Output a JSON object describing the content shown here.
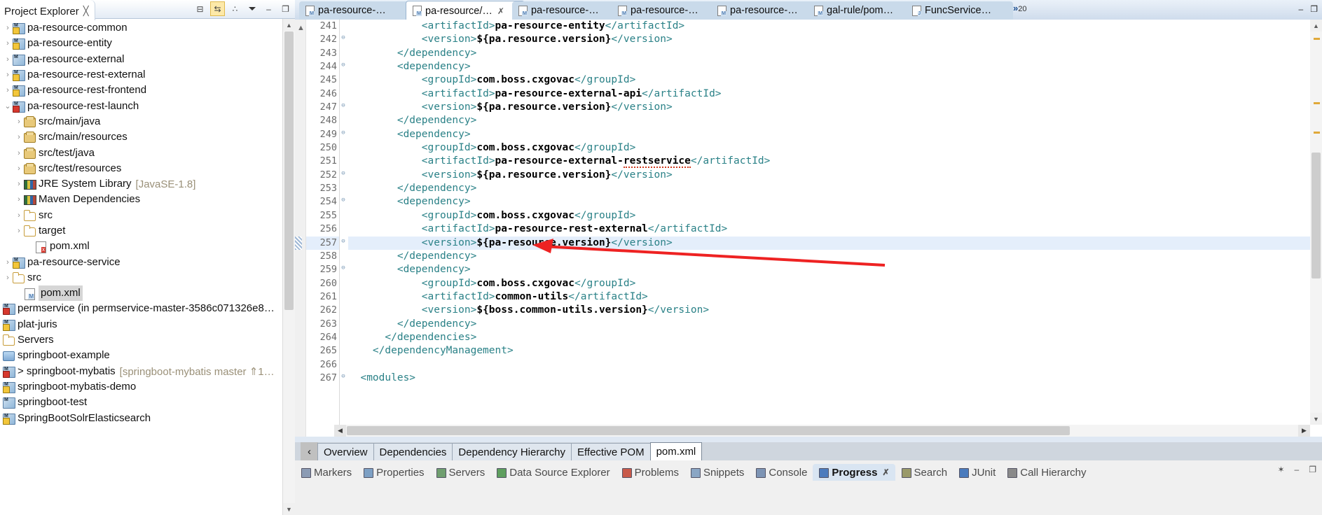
{
  "explorer": {
    "title": "Project Explorer",
    "close_glyph": "╳",
    "toolbar": [
      {
        "name": "collapse-all-button",
        "glyph": "⊟"
      },
      {
        "name": "link-with-editor-button",
        "glyph": "⇆"
      },
      {
        "name": "view-menu-button",
        "glyph": "∴"
      }
    ],
    "items": [
      {
        "label": "pa-resource-common",
        "indent": 0,
        "arrow": "›",
        "icon": "maven-project-warn-icon"
      },
      {
        "label": "pa-resource-entity",
        "indent": 0,
        "arrow": "›",
        "icon": "maven-project-warn-icon"
      },
      {
        "label": "pa-resource-external",
        "indent": 0,
        "arrow": "›",
        "icon": "maven-project-icon"
      },
      {
        "label": "pa-resource-rest-external",
        "indent": 0,
        "arrow": "›",
        "icon": "maven-project-warn-icon"
      },
      {
        "label": "pa-resource-rest-frontend",
        "indent": 0,
        "arrow": "›",
        "icon": "maven-project-warn-icon"
      },
      {
        "label": "pa-resource-rest-launch",
        "indent": 0,
        "arrow": "⌄",
        "icon": "maven-project-error-icon"
      },
      {
        "label": "src/main/java",
        "indent": 1,
        "arrow": "›",
        "icon": "source-package-icon"
      },
      {
        "label": "src/main/resources",
        "indent": 1,
        "arrow": "›",
        "icon": "source-package-icon"
      },
      {
        "label": "src/test/java",
        "indent": 1,
        "arrow": "›",
        "icon": "source-package-icon"
      },
      {
        "label": "src/test/resources",
        "indent": 1,
        "arrow": "›",
        "icon": "source-package-icon"
      },
      {
        "label": "JRE System Library",
        "indent": 1,
        "arrow": "›",
        "icon": "library-icon",
        "dim": "[JavaSE-1.8]"
      },
      {
        "label": "Maven Dependencies",
        "indent": 1,
        "arrow": "›",
        "icon": "library-icon"
      },
      {
        "label": "src",
        "indent": 1,
        "arrow": "›",
        "icon": "folder-icon"
      },
      {
        "label": "target",
        "indent": 1,
        "arrow": "›",
        "icon": "folder-icon"
      },
      {
        "label": "pom.xml",
        "indent": 2,
        "arrow": "",
        "icon": "xml-file-error-icon"
      },
      {
        "label": "pa-resource-service",
        "indent": 0,
        "arrow": "›",
        "icon": "maven-project-warn-icon"
      },
      {
        "label": "src",
        "indent": 0,
        "arrow": "›",
        "icon": "folder-icon"
      },
      {
        "label": "pom.xml",
        "indent": 1,
        "arrow": "",
        "icon": "xml-file-warn-icon",
        "selected": true
      },
      {
        "label": "permservice (in permservice-master-3586c071326e8…",
        "indent": -1,
        "arrow": "",
        "icon": "maven-project-error-icon"
      },
      {
        "label": "plat-juris",
        "indent": -1,
        "arrow": "",
        "icon": "maven-project-warn-icon"
      },
      {
        "label": "Servers",
        "indent": -1,
        "arrow": "",
        "icon": "folder-icon"
      },
      {
        "label": "springboot-example",
        "indent": -1,
        "arrow": "",
        "icon": "project-icon"
      },
      {
        "label": "> springboot-mybatis",
        "indent": -1,
        "arrow": "",
        "icon": "maven-project-error-icon",
        "dim": "[springboot-mybatis master ⇑1…"
      },
      {
        "label": "springboot-mybatis-demo",
        "indent": -1,
        "arrow": "",
        "icon": "maven-project-warn-icon"
      },
      {
        "label": "springboot-test",
        "indent": -1,
        "arrow": "",
        "icon": "maven-project-icon"
      },
      {
        "label": "SpringBootSolrElasticsearch",
        "indent": -1,
        "arrow": "",
        "icon": "maven-project-warn-icon"
      }
    ]
  },
  "editor_tabs": {
    "items": [
      {
        "label": "pa-resource-…",
        "active": false,
        "closable": false
      },
      {
        "label": "pa-resource/…",
        "active": true,
        "closable": true
      },
      {
        "label": "pa-resource-…",
        "active": false,
        "closable": false
      },
      {
        "label": "pa-resource-…",
        "active": false,
        "closable": false
      },
      {
        "label": "pa-resource-…",
        "active": false,
        "closable": false
      },
      {
        "label": "gal-rule/pom…",
        "active": false,
        "closable": false
      },
      {
        "label": "FuncService…",
        "active": false,
        "closable": false,
        "kind": "java"
      }
    ],
    "more_glyph": "»",
    "more_count": "20",
    "window_buttons": [
      {
        "name": "minimize-editor-button",
        "glyph": "–"
      },
      {
        "name": "maximize-editor-button",
        "glyph": "❐"
      }
    ]
  },
  "code": {
    "first_line": 241,
    "current_line": 257,
    "lines": [
      {
        "n": 241,
        "fold": false,
        "indent": 12,
        "segs": [
          {
            "t": "tag",
            "v": "<artifactId>"
          },
          {
            "t": "txt",
            "v": "pa-resource-entity"
          },
          {
            "t": "tag",
            "v": "</artifactId>"
          }
        ]
      },
      {
        "n": 242,
        "fold": true,
        "indent": 12,
        "segs": [
          {
            "t": "tag",
            "v": "<version>"
          },
          {
            "t": "txt",
            "v": "${pa.resource.version}"
          },
          {
            "t": "tag",
            "v": "</version>"
          }
        ]
      },
      {
        "n": 243,
        "fold": false,
        "indent": 8,
        "segs": [
          {
            "t": "tag",
            "v": "</dependency>"
          }
        ]
      },
      {
        "n": 244,
        "fold": true,
        "indent": 8,
        "segs": [
          {
            "t": "tag",
            "v": "<dependency>"
          }
        ]
      },
      {
        "n": 245,
        "fold": false,
        "indent": 12,
        "segs": [
          {
            "t": "tag",
            "v": "<groupId>"
          },
          {
            "t": "txt",
            "v": "com.boss.cxgovac"
          },
          {
            "t": "tag",
            "v": "</groupId>"
          }
        ]
      },
      {
        "n": 246,
        "fold": false,
        "indent": 12,
        "segs": [
          {
            "t": "tag",
            "v": "<artifactId>"
          },
          {
            "t": "txt",
            "v": "pa-resource-external-api"
          },
          {
            "t": "tag",
            "v": "</artifactId>"
          }
        ]
      },
      {
        "n": 247,
        "fold": true,
        "indent": 12,
        "segs": [
          {
            "t": "tag",
            "v": "<version>"
          },
          {
            "t": "txt",
            "v": "${pa.resource.version}"
          },
          {
            "t": "tag",
            "v": "</version>"
          }
        ]
      },
      {
        "n": 248,
        "fold": false,
        "indent": 8,
        "segs": [
          {
            "t": "tag",
            "v": "</dependency>"
          }
        ]
      },
      {
        "n": 249,
        "fold": true,
        "indent": 8,
        "segs": [
          {
            "t": "tag",
            "v": "<dependency>"
          }
        ]
      },
      {
        "n": 250,
        "fold": false,
        "indent": 12,
        "segs": [
          {
            "t": "tag",
            "v": "<groupId>"
          },
          {
            "t": "txt",
            "v": "com.boss.cxgovac"
          },
          {
            "t": "tag",
            "v": "</groupId>"
          }
        ]
      },
      {
        "n": 251,
        "fold": false,
        "indent": 12,
        "segs": [
          {
            "t": "tag",
            "v": "<artifactId>"
          },
          {
            "t": "txt",
            "v": "pa-resource-external-"
          },
          {
            "t": "txterr",
            "v": "restservice"
          },
          {
            "t": "tag",
            "v": "</artifactId>"
          }
        ]
      },
      {
        "n": 252,
        "fold": true,
        "indent": 12,
        "segs": [
          {
            "t": "tag",
            "v": "<version>"
          },
          {
            "t": "txt",
            "v": "${pa.resource.version}"
          },
          {
            "t": "tag",
            "v": "</version>"
          }
        ]
      },
      {
        "n": 253,
        "fold": false,
        "indent": 8,
        "segs": [
          {
            "t": "tag",
            "v": "</dependency>"
          }
        ]
      },
      {
        "n": 254,
        "fold": true,
        "indent": 8,
        "segs": [
          {
            "t": "tag",
            "v": "<dependency>"
          }
        ]
      },
      {
        "n": 255,
        "fold": false,
        "indent": 12,
        "segs": [
          {
            "t": "tag",
            "v": "<groupId>"
          },
          {
            "t": "txt",
            "v": "com.boss.cxgovac"
          },
          {
            "t": "tag",
            "v": "</groupId>"
          }
        ]
      },
      {
        "n": 256,
        "fold": false,
        "indent": 12,
        "segs": [
          {
            "t": "tag",
            "v": "<artifactId>"
          },
          {
            "t": "txt",
            "v": "pa-resource-rest-external"
          },
          {
            "t": "tag",
            "v": "</artifactId>"
          }
        ]
      },
      {
        "n": 257,
        "fold": true,
        "indent": 12,
        "cur": true,
        "segs": [
          {
            "t": "tag",
            "v": "<version>"
          },
          {
            "t": "txt",
            "v": "${pa-resource.version}"
          },
          {
            "t": "tag",
            "v": "</version>"
          }
        ]
      },
      {
        "n": 258,
        "fold": false,
        "indent": 8,
        "segs": [
          {
            "t": "tag",
            "v": "</dependency>"
          }
        ]
      },
      {
        "n": 259,
        "fold": true,
        "indent": 8,
        "segs": [
          {
            "t": "tag",
            "v": "<dependency>"
          }
        ]
      },
      {
        "n": 260,
        "fold": false,
        "indent": 12,
        "segs": [
          {
            "t": "tag",
            "v": "<groupId>"
          },
          {
            "t": "txt",
            "v": "com.boss.cxgovac"
          },
          {
            "t": "tag",
            "v": "</groupId>"
          }
        ]
      },
      {
        "n": 261,
        "fold": false,
        "indent": 12,
        "segs": [
          {
            "t": "tag",
            "v": "<artifactId>"
          },
          {
            "t": "txt",
            "v": "common-utils"
          },
          {
            "t": "tag",
            "v": "</artifactId>"
          }
        ]
      },
      {
        "n": 262,
        "fold": false,
        "indent": 12,
        "segs": [
          {
            "t": "tag",
            "v": "<version>"
          },
          {
            "t": "txt",
            "v": "${boss.common-utils.version}"
          },
          {
            "t": "tag",
            "v": "</version>"
          }
        ]
      },
      {
        "n": 263,
        "fold": false,
        "indent": 8,
        "segs": [
          {
            "t": "tag",
            "v": "</dependency>"
          }
        ]
      },
      {
        "n": 264,
        "fold": false,
        "indent": 6,
        "segs": [
          {
            "t": "tag",
            "v": "</dependencies>"
          }
        ]
      },
      {
        "n": 265,
        "fold": false,
        "indent": 4,
        "segs": [
          {
            "t": "tag",
            "v": "</dependencyManagement>"
          }
        ]
      },
      {
        "n": 266,
        "fold": false,
        "indent": 0,
        "segs": []
      },
      {
        "n": 267,
        "fold": true,
        "indent": 2,
        "segs": [
          {
            "t": "tag",
            "v": "<modules>"
          }
        ]
      }
    ]
  },
  "form_tabs": {
    "scroll_left_glyph": "‹",
    "items": [
      {
        "label": "Overview",
        "active": false
      },
      {
        "label": "Dependencies",
        "active": false
      },
      {
        "label": "Dependency Hierarchy",
        "active": false
      },
      {
        "label": "Effective POM",
        "active": false
      },
      {
        "label": "pom.xml",
        "active": true
      }
    ]
  },
  "view_tabs": {
    "items": [
      {
        "label": "Markers",
        "icon": "markers-icon",
        "active": false
      },
      {
        "label": "Properties",
        "icon": "properties-icon",
        "active": false
      },
      {
        "label": "Servers",
        "icon": "servers-icon",
        "active": false
      },
      {
        "label": "Data Source Explorer",
        "icon": "datasource-icon",
        "active": false
      },
      {
        "label": "Problems",
        "icon": "problems-icon",
        "active": false
      },
      {
        "label": "Snippets",
        "icon": "snippets-icon",
        "active": false
      },
      {
        "label": "Console",
        "icon": "console-icon",
        "active": false
      },
      {
        "label": "Progress",
        "icon": "progress-icon",
        "active": true,
        "closable": true
      },
      {
        "label": "Search",
        "icon": "search-icon",
        "active": false
      },
      {
        "label": "JUnit",
        "icon": "junit-icon",
        "active": false
      },
      {
        "label": "Call Hierarchy",
        "icon": "call-hierarchy-icon",
        "active": false
      }
    ],
    "right_icons": [
      {
        "name": "view-menu-icon",
        "glyph": "✶"
      },
      {
        "name": "minimize-view-icon",
        "glyph": "–"
      },
      {
        "name": "maximize-view-icon",
        "glyph": "❐"
      }
    ]
  },
  "colors": {
    "xml_tag": "#2a8187",
    "xml_text": "#000000",
    "current_line": "#e4eefb",
    "selection": "#d6d6d6",
    "annotation_arrow": "#ee2222",
    "tab_active": "#ffffff",
    "tab_inactive": "#c9daea"
  },
  "annotation": {
    "type": "red-arrow",
    "points_to": "line 257 version value"
  }
}
